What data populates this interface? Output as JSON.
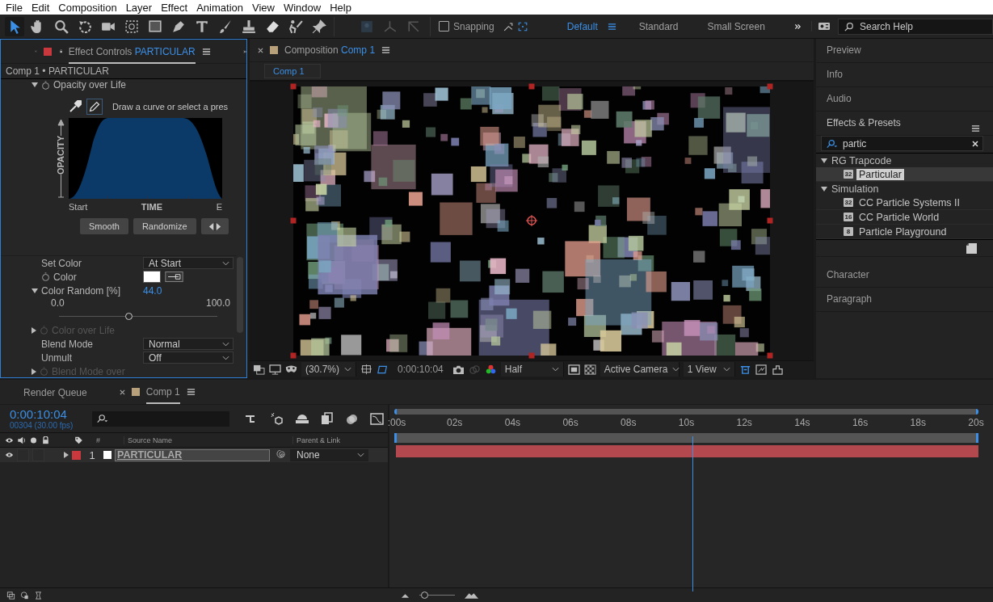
{
  "menu": [
    "File",
    "Edit",
    "Composition",
    "Layer",
    "Effect",
    "Animation",
    "View",
    "Window",
    "Help"
  ],
  "toolbar": {
    "snapping": {
      "label": "Snapping",
      "checked": false
    },
    "workspaces": [
      {
        "label": "Default",
        "selected": true
      },
      {
        "label": "Standard",
        "selected": false
      },
      {
        "label": "Small Screen",
        "selected": false
      }
    ],
    "search_help": {
      "placeholder": "Search Help"
    }
  },
  "effect_controls": {
    "tab": {
      "title": "Effect Controls",
      "layer": "PARTICULAR"
    },
    "breadcrumb": "Comp 1 • PARTICULAR",
    "section": {
      "label": "Opacity over Life",
      "expanded": true
    },
    "graph": {
      "hint": "Draw a curve or select a pres",
      "y_label": "OPACITY",
      "x_labels": [
        "Start",
        "TIME",
        "E"
      ],
      "buttons": [
        "Smooth",
        "Randomize"
      ]
    },
    "properties": [
      {
        "kind": "dropdown",
        "label": "Set Color",
        "value": "At Start",
        "stopwatch": false,
        "disabled": false
      },
      {
        "kind": "color",
        "label": "Color",
        "color": "#ffffff",
        "stopwatch": true,
        "disabled": false
      },
      {
        "kind": "slider",
        "label": "Color Random [%]",
        "value": "44.0",
        "min": "0.0",
        "max": "100.0",
        "level": 0.44,
        "expanded": true,
        "stopwatch": false,
        "disabled": false
      },
      {
        "kind": "group",
        "label": "Color over Life",
        "expanded": false,
        "stopwatch": true,
        "disabled": true
      },
      {
        "kind": "dropdown",
        "label": "Blend Mode",
        "value": "Normal",
        "stopwatch": false,
        "disabled": false
      },
      {
        "kind": "dropdown",
        "label": "Unmult",
        "value": "Off",
        "stopwatch": false,
        "disabled": false
      },
      {
        "kind": "group",
        "label": "Blend Mode over",
        "expanded": false,
        "stopwatch": true,
        "disabled": true
      }
    ]
  },
  "composition": {
    "tab": {
      "title": "Composition",
      "comp": "Comp 1"
    },
    "subtab": "Comp 1",
    "zoom": "(30.7%)",
    "timecode": "0:00:10:04",
    "resolution": "Half",
    "camera": "Active Camera",
    "views": "1 View"
  },
  "side": {
    "panels_above": [
      "Preview",
      "Info",
      "Audio"
    ],
    "effects_presets": {
      "title": "Effects & Presets",
      "search": "partic",
      "tree": [
        {
          "label": "RG Trapcode",
          "expanded": true,
          "children": [
            {
              "label": "Particular",
              "bit_depth": "32",
              "selected": true
            }
          ]
        },
        {
          "label": "Simulation",
          "expanded": true,
          "children": [
            {
              "label": "CC Particle Systems II",
              "bit_depth": "32",
              "selected": false
            },
            {
              "label": "CC Particle World",
              "bit_depth": "16",
              "selected": false
            },
            {
              "label": "Particle Playground",
              "bit_depth": "8",
              "selected": false
            }
          ]
        }
      ]
    },
    "panels_below": [
      "Character",
      "Paragraph"
    ]
  },
  "timeline": {
    "tabs": [
      {
        "label": "Render Queue",
        "selected": false
      },
      {
        "label": "Comp 1",
        "selected": true
      }
    ],
    "timecode": "0:00:10:04",
    "frame_info": "00304 (30.00 fps)",
    "columns": [
      "#",
      "Source Name",
      "Parent & Link"
    ],
    "layers": [
      {
        "number": "1",
        "name": "PARTICULAR",
        "parent": "None"
      }
    ],
    "ruler": [
      ":00s",
      "02s",
      "04s",
      "06s",
      "08s",
      "10s",
      "12s",
      "14s",
      "16s",
      "18s",
      "20s"
    ],
    "playhead": {
      "level": 0.506
    },
    "zoom": {
      "level": 0.05
    }
  }
}
